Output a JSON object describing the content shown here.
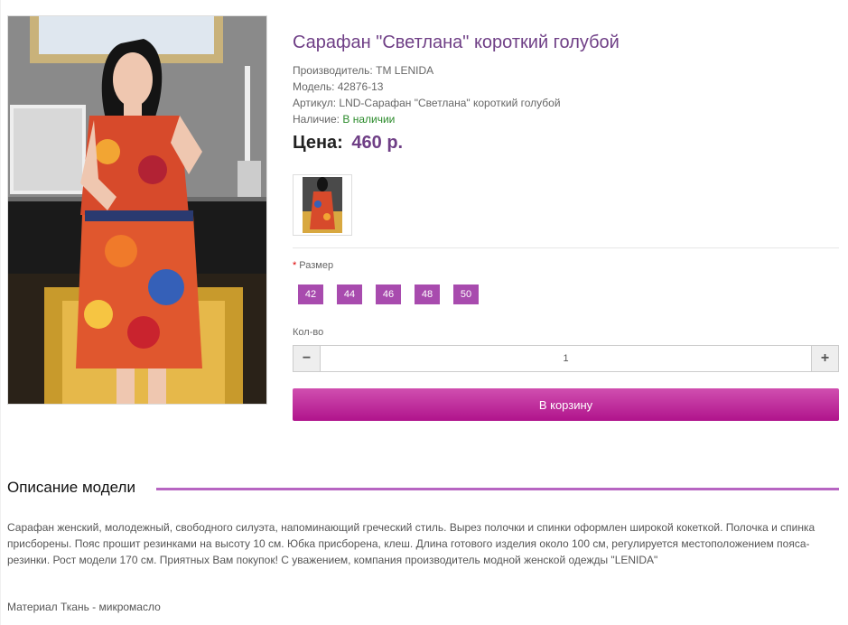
{
  "product": {
    "title": "Сарафан \"Светлана\" короткий голубой",
    "manufacturer_label": "Производитель:",
    "manufacturer": "TM LENIDA",
    "model_label": "Модель:",
    "model": "42876-13",
    "sku_label": "Артикул:",
    "sku": "LND-Сарафан \"Светлана\" короткий голубой",
    "availability_label": "Наличие:",
    "availability": "В наличии",
    "price_label": "Цена:",
    "price": "460 р."
  },
  "options": {
    "size_required_mark": "*",
    "size_label": "Размер",
    "sizes": [
      "42",
      "44",
      "46",
      "48",
      "50"
    ],
    "qty_label": "Кол-во",
    "qty_value": "1",
    "minus_icon": "−",
    "plus_icon": "+"
  },
  "cart": {
    "button_label": "В корзину"
  },
  "description": {
    "heading": "Описание модели",
    "text": "Сарафан женский, молодежный, свободного силуэта, напоминающий греческий стиль. Вырез полочки и спинки оформлен широкой кокеткой. Полочка и спинка присборены. Пояс прошит резинками на высоту 10 см. Юбка присборена, клеш. Длина готового изделия около 100 см, регулируется местоположением пояса-резинки. Рост модели 170 см. Приятных Вам покупок! С уважением, компания производитель модной женской одежды \"LENIDA\"",
    "material": "Материал Ткань - микромасло"
  },
  "colors": {
    "accent": "#6f3f86",
    "size_bg": "#a84bae",
    "cart_bg": "#b0138c",
    "availability": "#2a8a2a"
  }
}
